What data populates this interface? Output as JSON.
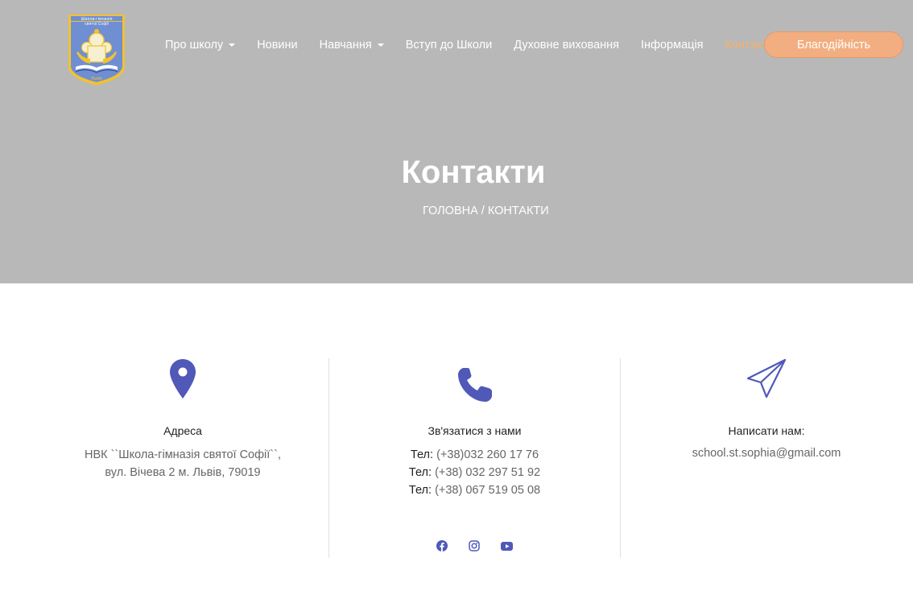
{
  "header": {
    "logo_text_top": "Школа-гімназія",
    "logo_text_mid": "святої Софії",
    "logo_text_bottom": "Львів",
    "nav": [
      {
        "label": "Про школу",
        "has_dropdown": true,
        "active": false
      },
      {
        "label": "Новини",
        "has_dropdown": false,
        "active": false
      },
      {
        "label": "Навчання",
        "has_dropdown": true,
        "active": false
      },
      {
        "label": "Вступ до Школи",
        "has_dropdown": false,
        "active": false
      },
      {
        "label": "Духовне виховання",
        "has_dropdown": false,
        "active": false
      },
      {
        "label": "Інформація",
        "has_dropdown": false,
        "active": false
      },
      {
        "label": "Контакти",
        "has_dropdown": false,
        "active": true
      }
    ],
    "donate_label": "Благодійність"
  },
  "hero": {
    "title": "Контакти",
    "breadcrumb_home": "ГОЛОВНА",
    "breadcrumb_sep": "/",
    "breadcrumb_current": "КОНТАКТИ"
  },
  "contacts": {
    "address": {
      "icon": "map-pin-icon",
      "title": "Адреса",
      "line1": "НВК ``Школа-гімназія святої Софії``,",
      "line2": "вул. Вічева 2 м. Львів, 79019"
    },
    "phone": {
      "icon": "phone-icon",
      "title": "Зв'язатися з нами",
      "phones": [
        {
          "label": "Тел:",
          "number": "(+38)032 260 17 76"
        },
        {
          "label": "Тел:",
          "number": "(+38) 032 297 51 92"
        },
        {
          "label": "Тел:",
          "number": "(+38) 067 519 05 08"
        }
      ],
      "social": [
        "facebook-icon",
        "instagram-icon",
        "youtube-icon"
      ]
    },
    "email": {
      "icon": "paper-plane-icon",
      "title": "Написати нам:",
      "address": "school.st.sophia@gmail.com"
    }
  },
  "colors": {
    "hero_bg": "#b8b8b8",
    "accent": "#f6b06c",
    "donate_bg": "#f2ae80",
    "icon": "#5058b8"
  }
}
